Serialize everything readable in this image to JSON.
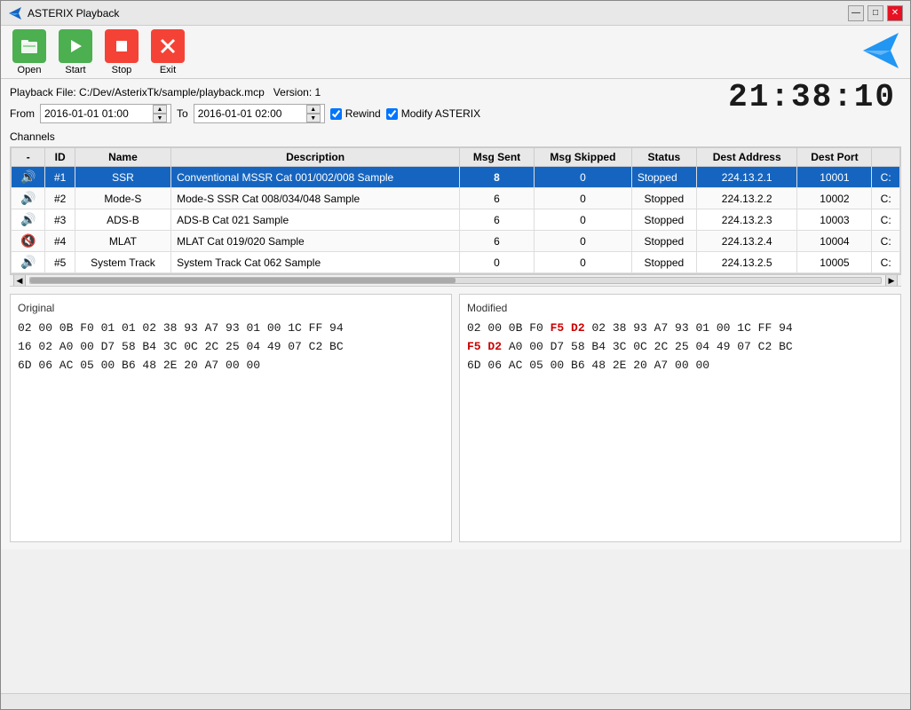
{
  "titlebar": {
    "title": "ASTERIX Playback",
    "min_btn": "—",
    "max_btn": "□",
    "close_btn": "✕"
  },
  "toolbar": {
    "open_label": "Open",
    "start_label": "Start",
    "stop_label": "Stop",
    "exit_label": "Exit"
  },
  "playback": {
    "label_file": "Playback File:",
    "filepath": "C:/Dev/AsterixTk/sample/playback.mcp",
    "version_label": "Version:",
    "version": "1",
    "from_label": "From",
    "from_value": "2016-01-01 01:00",
    "to_label": "To",
    "to_value": "2016-01-01 02:00",
    "rewind_label": "Rewind",
    "rewind_checked": true,
    "modify_label": "Modify ASTERIX",
    "modify_checked": true
  },
  "clock": {
    "display": "21:38:10"
  },
  "channels": {
    "section_label": "Channels",
    "columns": [
      "-",
      "ID",
      "Name",
      "Description",
      "Msg Sent",
      "Msg Skipped",
      "Status",
      "Dest Address",
      "Dest Port",
      ""
    ],
    "rows": [
      {
        "mute": "🔊",
        "id": "#1",
        "name": "SSR",
        "description": "Conventional MSSR Cat 001/002/008 Sample",
        "msg_sent": "8",
        "msg_skipped": "0",
        "status": "Stopped",
        "dest_address": "224.13.2.1",
        "dest_port": "10001",
        "extra": "C:",
        "selected": true
      },
      {
        "mute": "🔊",
        "id": "#2",
        "name": "Mode-S",
        "description": "Mode-S SSR Cat 008/034/048 Sample",
        "msg_sent": "6",
        "msg_skipped": "0",
        "status": "Stopped",
        "dest_address": "224.13.2.2",
        "dest_port": "10002",
        "extra": "C:",
        "selected": false
      },
      {
        "mute": "🔊",
        "id": "#3",
        "name": "ADS-B",
        "description": "ADS-B Cat 021 Sample",
        "msg_sent": "6",
        "msg_skipped": "0",
        "status": "Stopped",
        "dest_address": "224.13.2.3",
        "dest_port": "10003",
        "extra": "C:",
        "selected": false
      },
      {
        "mute": "🔊",
        "id": "#4",
        "name": "MLAT",
        "description": "MLAT Cat 019/020 Sample",
        "msg_sent": "6",
        "msg_skipped": "0",
        "status": "Stopped",
        "dest_address": "224.13.2.4",
        "dest_port": "10004",
        "extra": "C:",
        "selected": false,
        "muted": true
      },
      {
        "mute": "🔊",
        "id": "#5",
        "name": "System Track",
        "description": "System Track Cat 062 Sample",
        "msg_sent": "0",
        "msg_skipped": "0",
        "status": "Stopped",
        "dest_address": "224.13.2.5",
        "dest_port": "10005",
        "extra": "C:",
        "selected": false
      }
    ]
  },
  "original_panel": {
    "title": "Original",
    "lines": [
      {
        "text": "02 00 0B F0 01 01 02 38 93 A7 93 01 00 1C FF 94"
      },
      {
        "text": "16 02 A0 00 D7 58 B4 3C 0C 2C 25 04 49 07 C2 BC"
      },
      {
        "text": "6D 06 AC 05 00 B6 48 2E 20 A7 00 00"
      }
    ]
  },
  "modified_panel": {
    "title": "Modified",
    "line1_normal": "02 00 0B F0 ",
    "line1_highlight": "F5 D2",
    "line1_rest": " 02 38 93 A7 93 01 00 1C FF 94",
    "line2_highlight": "F5 D2",
    "line2_rest": " A0 00 D7 58 B4 3C 0C 2C 25 04 49 07 C2 BC",
    "line3": "6D 06 AC 05 00 B6 48 2E 20 A7 00 00"
  }
}
